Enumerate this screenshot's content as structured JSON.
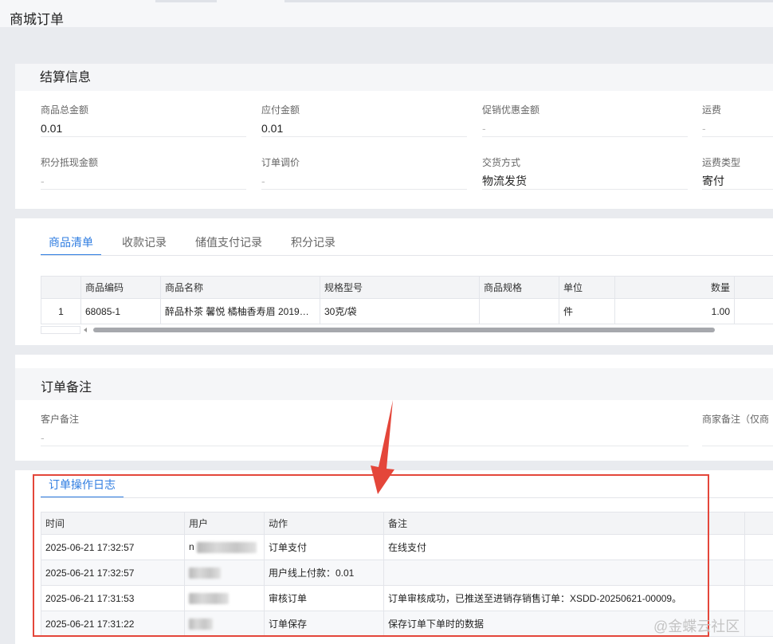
{
  "page": {
    "title": "商城订单"
  },
  "settlement": {
    "title": "结算信息",
    "fields": [
      {
        "label": "商品总金额",
        "value": "0.01"
      },
      {
        "label": "应付金额",
        "value": "0.01"
      },
      {
        "label": "促销优惠金额",
        "value": "-"
      },
      {
        "label": "运费",
        "value": "-"
      },
      {
        "label": "积分抵现金额",
        "value": "-"
      },
      {
        "label": "订单调价",
        "value": "-"
      },
      {
        "label": "交货方式",
        "value": "物流发货"
      },
      {
        "label": "运费类型",
        "value": "寄付"
      }
    ]
  },
  "goods": {
    "tabs": [
      {
        "label": "商品清单"
      },
      {
        "label": "收款记录"
      },
      {
        "label": "储值支付记录"
      },
      {
        "label": "积分记录"
      }
    ],
    "columns": [
      "",
      "商品编码",
      "商品名称",
      "规格型号",
      "商品规格",
      "单位",
      "数量"
    ],
    "rows": [
      {
        "index": "1",
        "code": "68085-1",
        "name": "醉品朴茶 馨悦 橘柚香寿眉 2019…",
        "model": "30克/袋",
        "spec": "",
        "unit": "件",
        "qty": "1.00"
      }
    ]
  },
  "remarks": {
    "title": "订单备注",
    "customer_label": "客户备注",
    "customer_value": "-",
    "merchant_label": "商家备注（仅商"
  },
  "log": {
    "tab": "订单操作日志",
    "columns": [
      "时间",
      "用户",
      "动作",
      "备注"
    ],
    "rows": [
      {
        "time": "2025-06-21 17:32:57",
        "user": "n",
        "action": "订单支付",
        "note": "在线支付"
      },
      {
        "time": "2025-06-21 17:32:57",
        "user": "",
        "action": "用户线上付款：0.01",
        "note": ""
      },
      {
        "time": "2025-06-21 17:31:53",
        "user": "",
        "action": "审核订单",
        "note": "订单审核成功，已推送至进销存销售订单：XSDD-20250621-00009。"
      },
      {
        "time": "2025-06-21 17:31:22",
        "user": "",
        "action": "订单保存",
        "note": "保存订单下单时的数据"
      }
    ]
  },
  "watermark": "@金蝶云社区",
  "colors": {
    "accent": "#2f7de1",
    "highlight": "#e4463a"
  }
}
